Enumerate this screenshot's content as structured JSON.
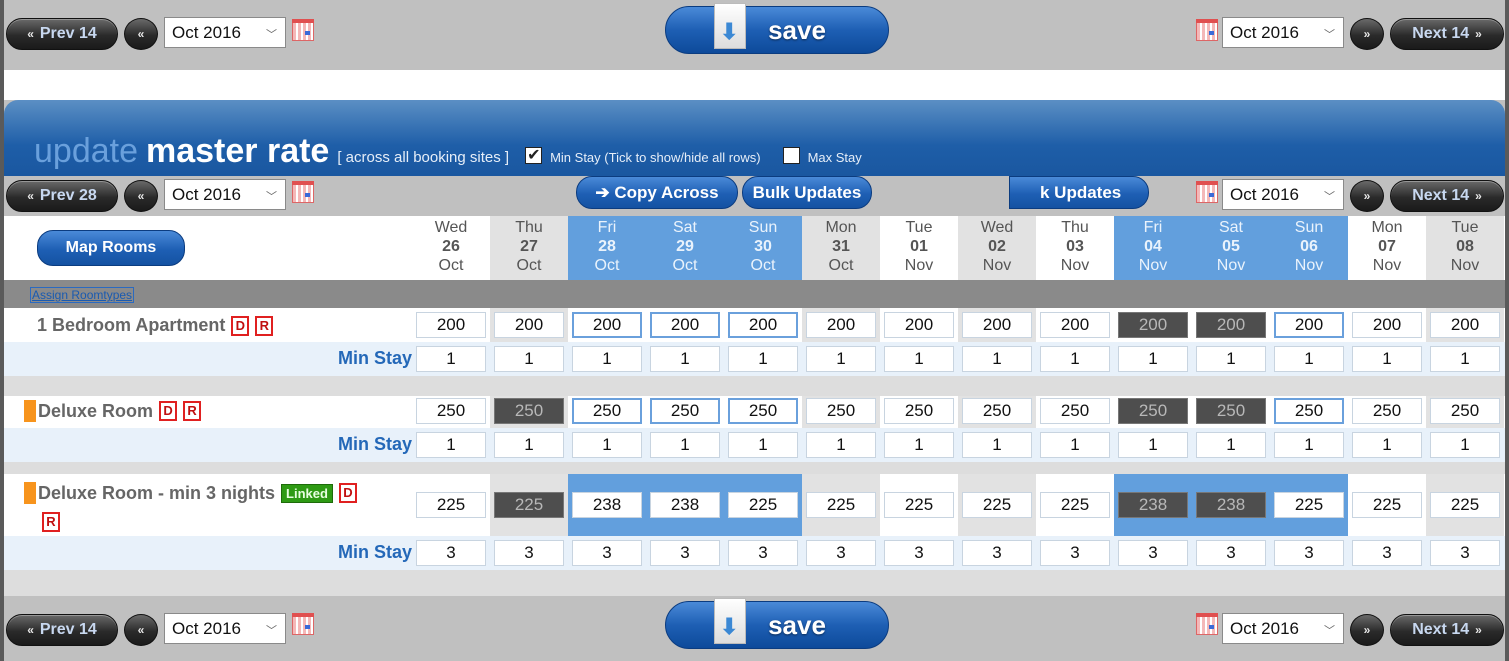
{
  "nav": {
    "prev14": "Prev 14",
    "prev28": "Prev 28",
    "next14": "Next 14",
    "month": "Oct 2016",
    "save": "save"
  },
  "header": {
    "title_light": "update",
    "title_bold": "master rate",
    "subtitle": "[ across all booking sites ]",
    "min_stay_toggle": {
      "label": "Min Stay (Tick to show/hide all rows)",
      "checked": true
    },
    "max_stay_toggle": {
      "label": "Max Stay",
      "checked": false
    }
  },
  "toolbar": {
    "copy_across": "➔ Copy Across",
    "bulk_updates": "Bulk Updates",
    "bulk_updates_clipped": "k Updates",
    "map_rooms": "Map Rooms",
    "assign_roomtypes": "Assign Roomtypes"
  },
  "days": [
    {
      "dow": "Wed",
      "d": "26",
      "m": "Oct",
      "style": "plain"
    },
    {
      "dow": "Thu",
      "d": "27",
      "m": "Oct",
      "style": "alt"
    },
    {
      "dow": "Fri",
      "d": "28",
      "m": "Oct",
      "style": "wknd"
    },
    {
      "dow": "Sat",
      "d": "29",
      "m": "Oct",
      "style": "wknd"
    },
    {
      "dow": "Sun",
      "d": "30",
      "m": "Oct",
      "style": "wknd"
    },
    {
      "dow": "Mon",
      "d": "31",
      "m": "Oct",
      "style": "alt"
    },
    {
      "dow": "Tue",
      "d": "01",
      "m": "Nov",
      "style": "plain"
    },
    {
      "dow": "Wed",
      "d": "02",
      "m": "Nov",
      "style": "alt"
    },
    {
      "dow": "Thu",
      "d": "03",
      "m": "Nov",
      "style": "plain"
    },
    {
      "dow": "Fri",
      "d": "04",
      "m": "Nov",
      "style": "wknd"
    },
    {
      "dow": "Sat",
      "d": "05",
      "m": "Nov",
      "style": "wknd"
    },
    {
      "dow": "Sun",
      "d": "06",
      "m": "Nov",
      "style": "wknd"
    },
    {
      "dow": "Mon",
      "d": "07",
      "m": "Nov",
      "style": "plain"
    },
    {
      "dow": "Tue",
      "d": "08",
      "m": "Nov",
      "style": "alt"
    }
  ],
  "min_stay_label": "Min Stay",
  "rooms": [
    {
      "name": "1 Bedroom Apartment",
      "orange": false,
      "linked": false,
      "badges": [
        "D",
        "R"
      ],
      "rates": [
        "200",
        "200",
        "200",
        "200",
        "200",
        "200",
        "200",
        "200",
        "200",
        "200",
        "200",
        "200",
        "200",
        "200"
      ],
      "blocked": [
        false,
        false,
        false,
        false,
        false,
        false,
        false,
        false,
        false,
        true,
        true,
        false,
        false,
        false
      ],
      "min_stay": [
        "1",
        "1",
        "1",
        "1",
        "1",
        "1",
        "1",
        "1",
        "1",
        "1",
        "1",
        "1",
        "1",
        "1"
      ]
    },
    {
      "name": "Deluxe Room",
      "orange": true,
      "linked": false,
      "badges": [
        "D",
        "R"
      ],
      "rates": [
        "250",
        "250",
        "250",
        "250",
        "250",
        "250",
        "250",
        "250",
        "250",
        "250",
        "250",
        "250",
        "250",
        "250"
      ],
      "blocked": [
        false,
        true,
        false,
        false,
        false,
        false,
        false,
        false,
        false,
        true,
        true,
        false,
        false,
        false
      ],
      "min_stay": [
        "1",
        "1",
        "1",
        "1",
        "1",
        "1",
        "1",
        "1",
        "1",
        "1",
        "1",
        "1",
        "1",
        "1"
      ]
    },
    {
      "name": "Deluxe Room - min 3 nights",
      "orange": true,
      "linked": true,
      "linked_label": "Linked",
      "badges": [
        "D",
        "R"
      ],
      "rates": [
        "225",
        "225",
        "238",
        "238",
        "225",
        "225",
        "225",
        "225",
        "225",
        "238",
        "238",
        "225",
        "225",
        "225"
      ],
      "blocked": [
        false,
        true,
        false,
        false,
        false,
        false,
        false,
        false,
        false,
        true,
        true,
        false,
        false,
        false
      ],
      "min_stay": [
        "3",
        "3",
        "3",
        "3",
        "3",
        "3",
        "3",
        "3",
        "3",
        "3",
        "3",
        "3",
        "3",
        "3"
      ]
    }
  ]
}
